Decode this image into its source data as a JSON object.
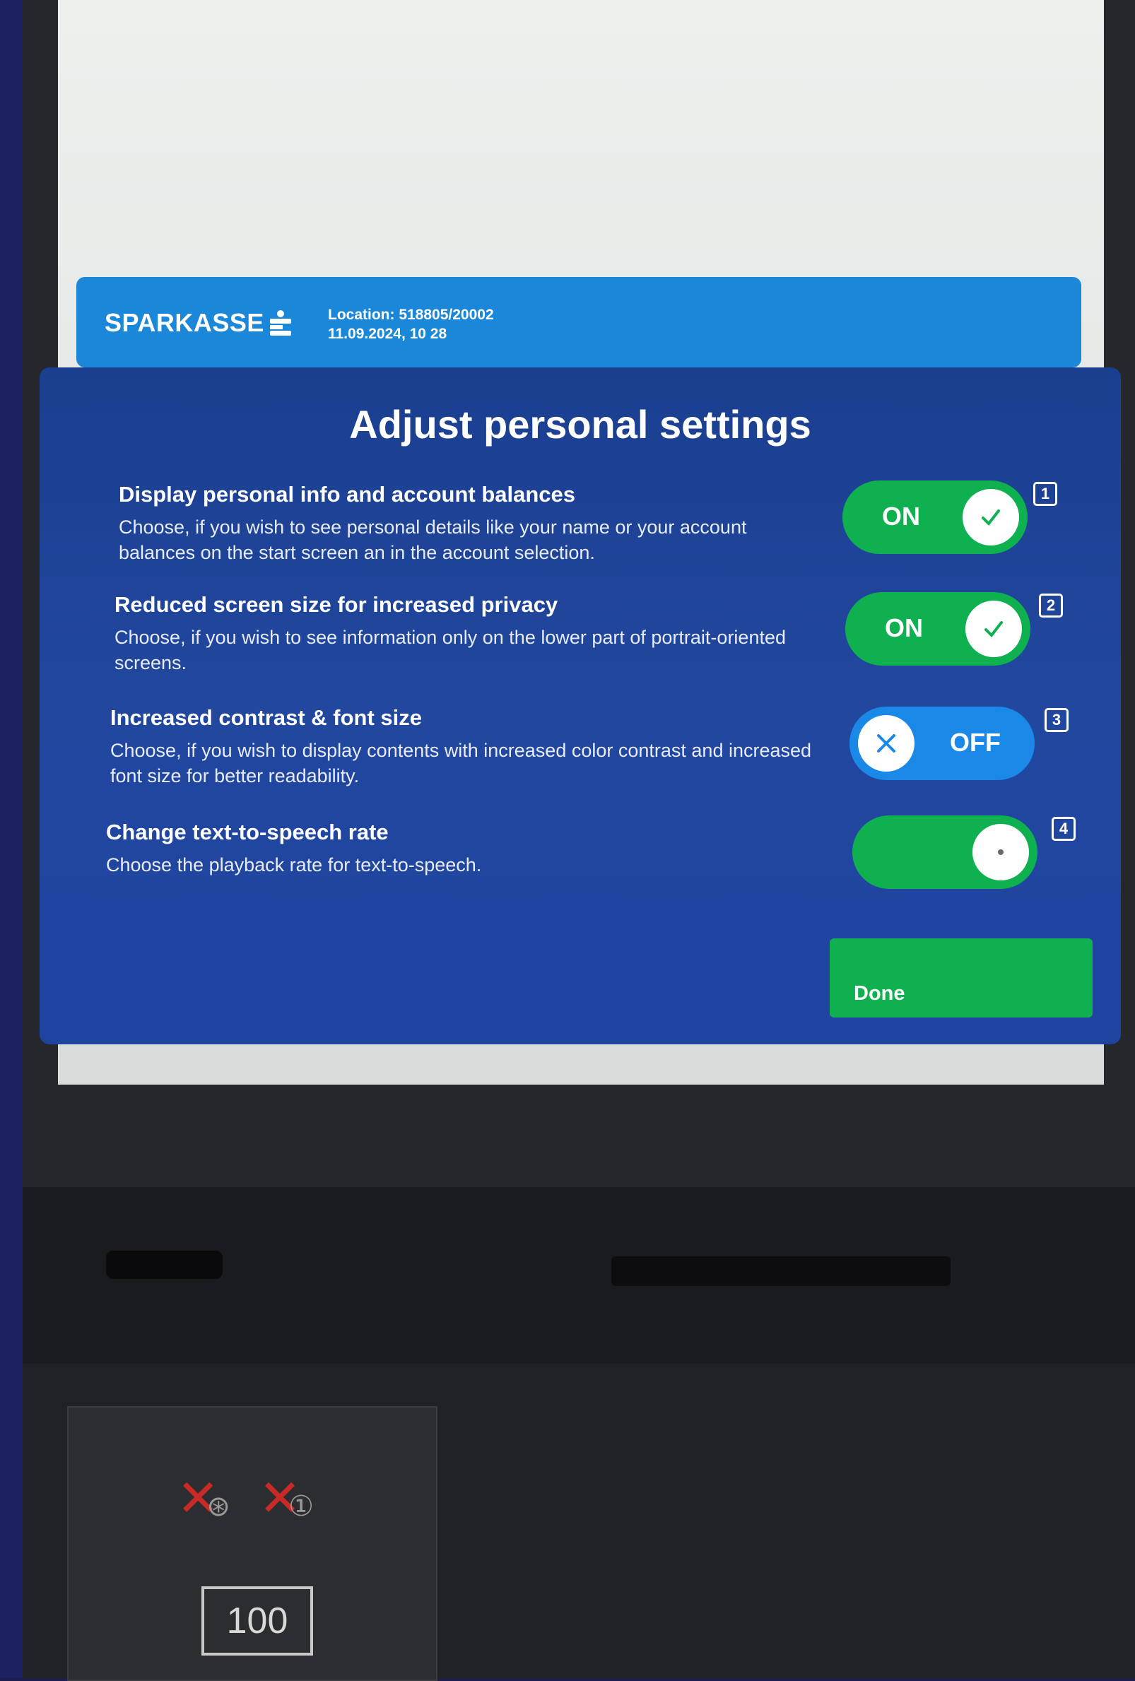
{
  "header": {
    "brand": "SPARKASSE",
    "location": "Location: 518805/20002",
    "datetime": "11.09.2024, 10 28"
  },
  "page": {
    "title": "Adjust personal settings"
  },
  "settings": [
    {
      "title": "Display personal info and account balances",
      "description": "Choose, if you wish to see personal details like your name or your account balances on the start screen an in the account selection.",
      "state": "ON",
      "badge": "1"
    },
    {
      "title": "Reduced screen size for increased privacy",
      "description": "Choose, if you wish to see information only on the lower part of portrait-oriented screens.",
      "state": "ON",
      "badge": "2"
    },
    {
      "title": "Increased contrast & font size",
      "description": "Choose, if you wish to display contents with increased color contrast and increased font size for better readability.",
      "state": "OFF",
      "badge": "3"
    },
    {
      "title": "Change text-to-speech rate",
      "description": "Choose the playback rate for text-to-speech.",
      "state": "",
      "badge": "4"
    }
  ],
  "done_label": "Done",
  "cash_panel": {
    "note_value": "100"
  },
  "colors": {
    "header": "#1b87d9",
    "panel": "#1e44a0",
    "on": "#0fb04f",
    "off": "#1a88e6"
  },
  "icons": [
    "sparkasse-logo-icon",
    "check-icon",
    "close-icon",
    "dot-icon",
    "no-coins-icon",
    "banknote-icon"
  ]
}
